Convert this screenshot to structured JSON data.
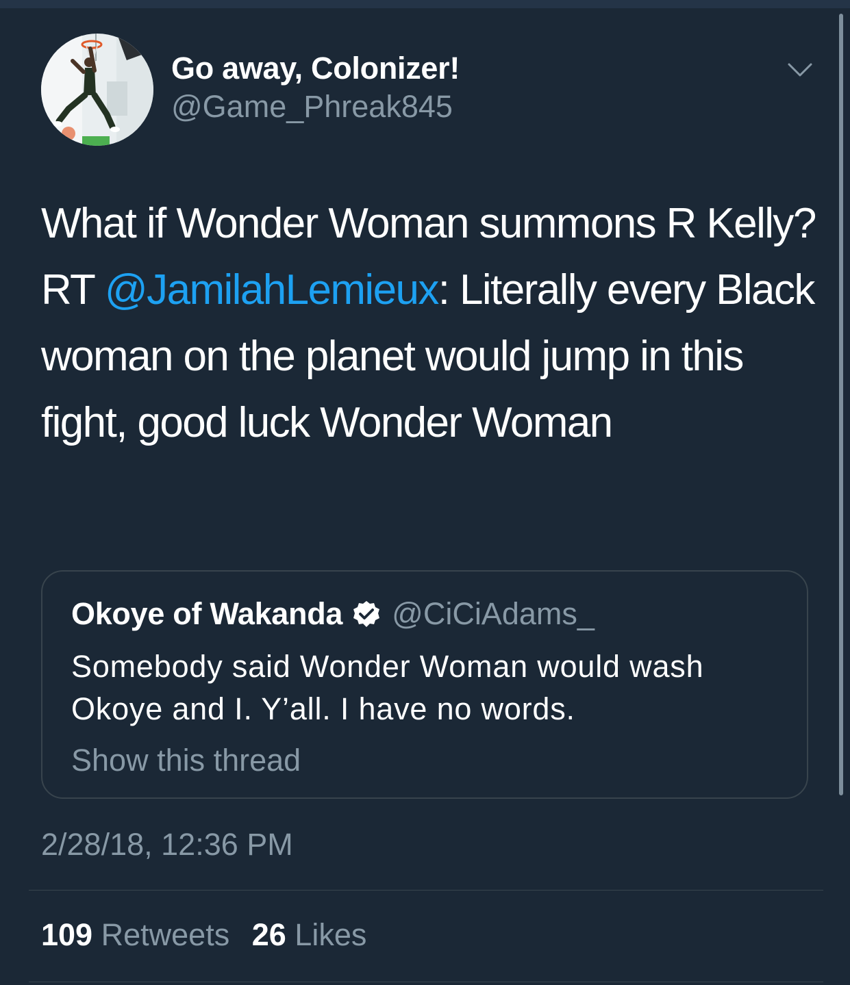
{
  "tweet": {
    "author": {
      "display_name": "Go away, Colonizer!",
      "handle": "@Game_Phreak845"
    },
    "text": {
      "before_mention": "What if Wonder Woman summons R Kelly? RT ",
      "mention": "@JamilahLemieux",
      "after_mention": ": Literally every Black woman on the planet would jump in this fight, good luck Wonder Woman"
    },
    "quoted": {
      "display_name": "Okoye of Wakanda",
      "handle": "@CiCiAdams_",
      "text": "Somebody said Wonder Woman would wash Okoye and I. Y’all. I have no words.",
      "show_thread_label": "Show this thread"
    },
    "timestamp": "2/28/18, 12:36 PM",
    "stats": {
      "retweets_count": "109",
      "retweets_label": "Retweets",
      "likes_count": "26",
      "likes_label": "Likes"
    }
  },
  "icons": {
    "menu": "chevron-down-icon",
    "verified": "verified-badge-icon"
  },
  "colors": {
    "background": "#1b2836",
    "text": "#ffffff",
    "secondary_text": "#8899a6",
    "link": "#1da1f2",
    "border": "#38444d"
  }
}
